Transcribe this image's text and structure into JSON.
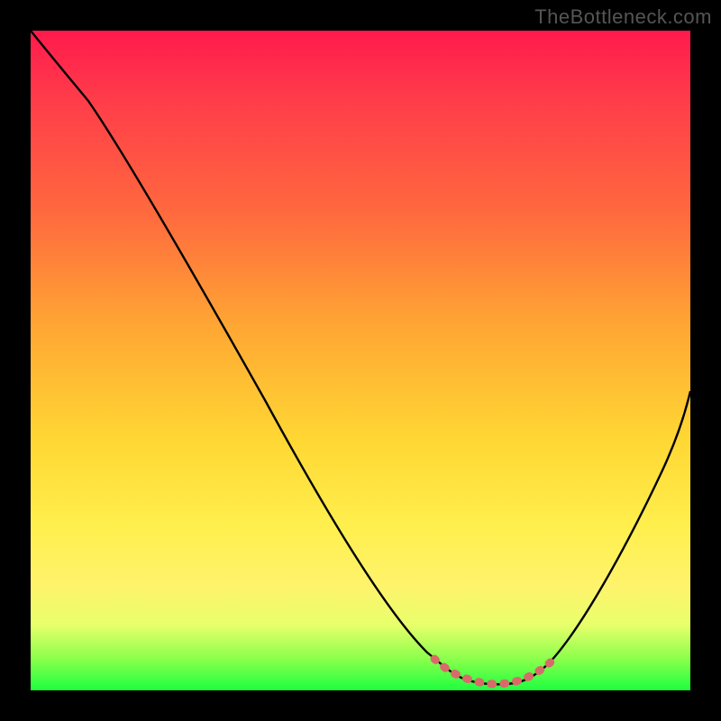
{
  "watermark": "TheBottleneck.com",
  "chart_data": {
    "type": "line",
    "title": "",
    "xlabel": "",
    "ylabel": "",
    "xlim": [
      0,
      100
    ],
    "ylim": [
      0,
      100
    ],
    "series": [
      {
        "name": "main-curve",
        "x": [
          0,
          5,
          8,
          12,
          20,
          30,
          40,
          50,
          58,
          61,
          64,
          67,
          70,
          73,
          75,
          77,
          80,
          85,
          90,
          95,
          100
        ],
        "values": [
          100,
          98,
          95,
          90,
          76,
          59,
          42,
          25,
          11,
          6,
          3,
          1.5,
          1,
          1,
          1.5,
          2.5,
          6,
          15,
          27,
          40,
          53
        ]
      },
      {
        "name": "valley-marker",
        "x": [
          61,
          63,
          65,
          67,
          69,
          71,
          73,
          75,
          77,
          79
        ],
        "values": [
          4.5,
          3,
          2,
          1.5,
          1.2,
          1.2,
          1.4,
          1.8,
          2.8,
          4.2
        ]
      }
    ],
    "colors": {
      "curve": "#000000",
      "marker": "#d96a6a",
      "gradient_top": "#ff1a4d",
      "gradient_bottom": "#1eff3f"
    }
  }
}
